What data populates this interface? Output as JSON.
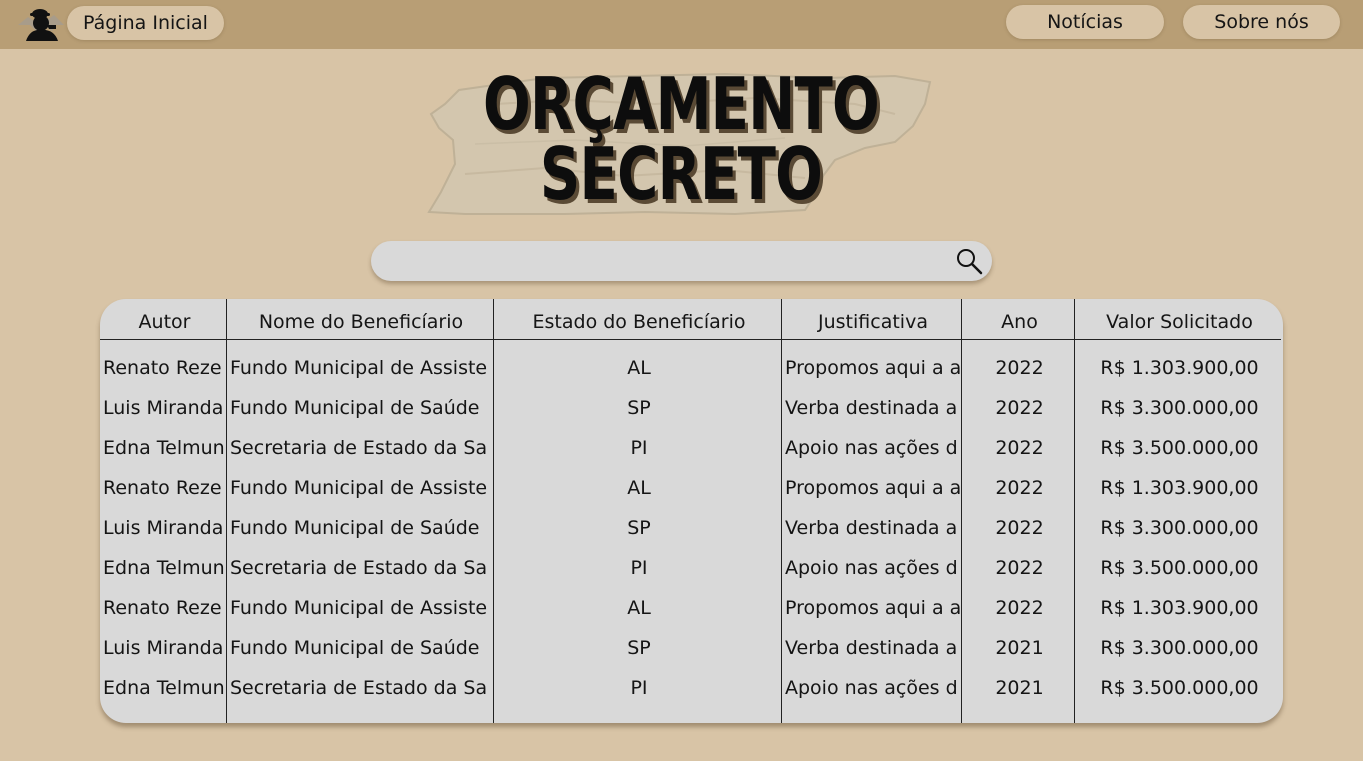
{
  "nav": {
    "home_label": "Página Inicial",
    "news_label": "Notícias",
    "about_label": "Sobre nós"
  },
  "title": {
    "line1": "ORÇAMENTO",
    "line2": "SECRETO"
  },
  "search": {
    "placeholder": "",
    "value": ""
  },
  "table": {
    "columns": [
      "Autor",
      "Nome do Beneficíario",
      "Estado do Beneficíario",
      "Justificativa",
      "Ano",
      "Valor Solicitado"
    ],
    "rows": [
      [
        "Renato Reze",
        "Fundo Municipal de Assiste",
        "AL",
        "Propomos aqui a a",
        "2022",
        "R$ 1.303.900,00"
      ],
      [
        "Luis Miranda",
        "Fundo Municipal de Saúde",
        "SP",
        "Verba destinada a",
        "2022",
        "R$ 3.300.000,00"
      ],
      [
        "Edna Telmun",
        "Secretaria de Estado da Sa",
        "PI",
        "Apoio nas ações d",
        "2022",
        "R$ 3.500.000,00"
      ],
      [
        "Renato Reze",
        "Fundo Municipal de Assiste",
        "AL",
        "Propomos aqui a a",
        "2022",
        "R$ 1.303.900,00"
      ],
      [
        "Luis Miranda",
        "Fundo Municipal de Saúde",
        "SP",
        "Verba destinada a",
        "2022",
        "R$ 3.300.000,00"
      ],
      [
        "Edna Telmun",
        "Secretaria de Estado da Sa",
        "PI",
        "Apoio nas ações d",
        "2022",
        "R$ 3.500.000,00"
      ],
      [
        "Renato Reze",
        "Fundo Municipal de Assiste",
        "AL",
        "Propomos aqui a a",
        "2022",
        "R$ 1.303.900,00"
      ],
      [
        "Luis Miranda",
        "Fundo Municipal de Saúde",
        "SP",
        "Verba destinada a",
        "2021",
        "R$ 3.300.000,00"
      ],
      [
        "Edna Telmun",
        "Secretaria de Estado da Sa",
        "PI",
        "Apoio nas ações d",
        "2021",
        "R$ 3.500.000,00"
      ]
    ]
  },
  "icons": {
    "logo": "detective-silhouette-icon",
    "search": "magnifier-icon"
  },
  "colors": {
    "background": "#d8c4a6",
    "navbar": "#b89e75",
    "card": "#d9d9d9",
    "text": "#151515"
  }
}
